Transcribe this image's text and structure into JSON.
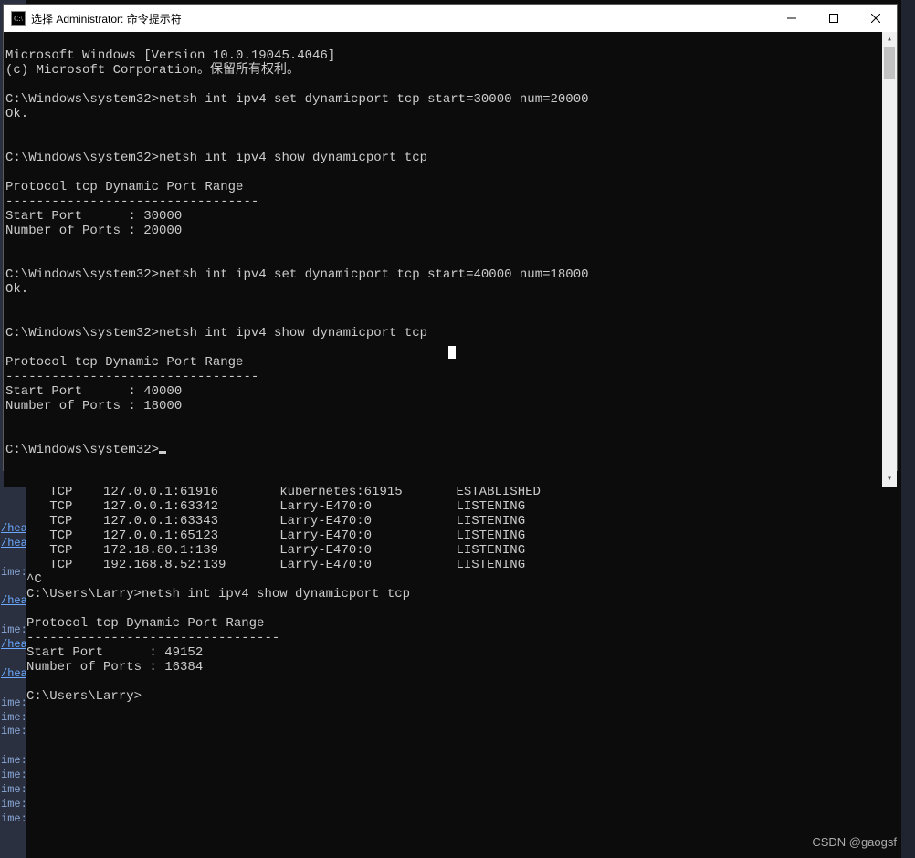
{
  "window": {
    "title": "选择 Administrator: 命令提示符",
    "icon_label": "C:\\"
  },
  "fg_terminal": {
    "line0": "Microsoft Windows [Version 10.0.19045.4046]",
    "line1": "(c) Microsoft Corporation。保留所有权利。",
    "blank": "",
    "prompt1": "C:\\Windows\\system32>netsh int ipv4 set dynamicport tcp start=30000 num=20000",
    "ok1": "Ok.",
    "prompt2": "C:\\Windows\\system32>netsh int ipv4 show dynamicport tcp",
    "hdr": "Protocol tcp Dynamic Port Range",
    "dash": "---------------------------------",
    "sp1": "Start Port      : 30000",
    "np1": "Number of Ports : 20000",
    "prompt3": "C:\\Windows\\system32>netsh int ipv4 set dynamicport tcp start=40000 num=18000",
    "ok2": "Ok.",
    "prompt4": "C:\\Windows\\system32>netsh int ipv4 show dynamicport tcp",
    "sp2": "Start Port      : 40000",
    "np2": "Number of Ports : 18000",
    "prompt5": "C:\\Windows\\system32>"
  },
  "bg_terminal": {
    "row1": "   TCP    127.0.0.1:61916        kubernetes:61915       ESTABLISHED",
    "row2": "   TCP    127.0.0.1:63342        Larry-E470:0           LISTENING",
    "row3": "   TCP    127.0.0.1:63343        Larry-E470:0           LISTENING",
    "row4": "   TCP    127.0.0.1:65123        Larry-E470:0           LISTENING",
    "row5": "   TCP    172.18.80.1:139        Larry-E470:0           LISTENING",
    "row6": "   TCP    192.168.8.52:139       Larry-E470:0           LISTENING",
    "ctrlc": "^C",
    "prompt1": "C:\\Users\\Larry>netsh int ipv4 show dynamicport tcp",
    "blank": "",
    "hdr": "Protocol tcp Dynamic Port Range",
    "dash": "---------------------------------",
    "sp": "Start Port      : 49152",
    "np": "Number of Ports : 16384",
    "prompt2": "C:\\Users\\Larry>"
  },
  "bg_gutter": {
    "hea": "/hea",
    "ime": "ime:"
  },
  "watermark": "CSDN @gaogsf"
}
